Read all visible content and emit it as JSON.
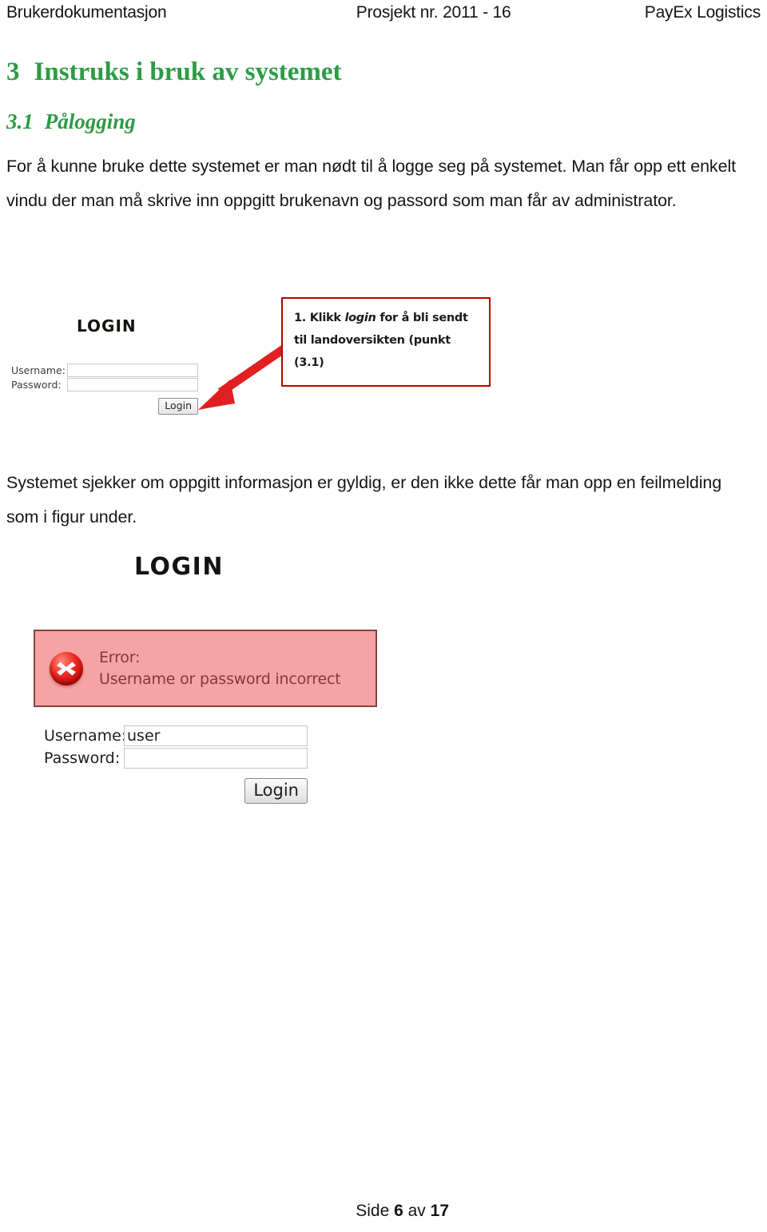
{
  "header": {
    "left": "Brukerdokumentasjon",
    "center": "Prosjekt nr. 2011 - 16",
    "right": "PayEx Logistics"
  },
  "headings": {
    "h1_number": "3",
    "h1_text": "Instruks i bruk av systemet",
    "h2_number": "3.1",
    "h2_text": "Pålogging",
    "color": "#2e9b45"
  },
  "paragraphs": {
    "p1": "For å kunne bruke dette systemet er man nødt til å logge seg på systemet. Man får opp ett enkelt vindu der man må skrive inn oppgitt brukenavn og passord som man får av administrator.",
    "p2": "Systemet sjekker om oppgitt informasjon er gyldig, er den ikke dette får man opp en feilmelding som i figur under."
  },
  "figure1": {
    "title": "LOGIN",
    "username_label": "Username:",
    "username_value": "",
    "password_label": "Password:",
    "password_value": "",
    "login_button": "Login",
    "arrow_color": "#e02020",
    "callout": {
      "border_color": "#c00000",
      "line1_before": "1. Klikk ",
      "line1_italic": "login",
      "line1_after": " for å bli sendt",
      "line2": "til landoversikten (punkt",
      "line3": "(3.1)"
    }
  },
  "figure2": {
    "title": "LOGIN",
    "error": {
      "label": "Error:",
      "message": "Username or password incorrect",
      "background": "#f5a3a3",
      "border_color": "#8a4040",
      "icon": "error-circle-x-icon"
    },
    "username_label": "Username:",
    "username_value": "user",
    "password_label": "Password:",
    "password_value": "",
    "login_button": "Login"
  },
  "footer": {
    "prefix": "Side ",
    "page": "6",
    "middle": " av ",
    "total": "17"
  }
}
